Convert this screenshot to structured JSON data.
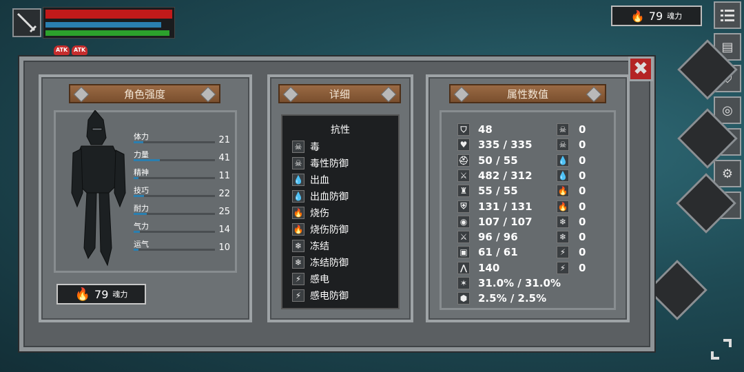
{
  "hud": {
    "atk1": "ATK",
    "atk2": "ATK"
  },
  "currency": {
    "value": "79",
    "unit": "魂力"
  },
  "right_menu": [
    "menu-icon",
    "map-icon",
    "armor-icon",
    "ring-icon",
    "crown-icon",
    "gear-icon",
    "help-icon"
  ],
  "help_label": "?",
  "close_label": "✖",
  "character": {
    "title": "角色强度",
    "stats": [
      {
        "label": "体力",
        "value": "21",
        "fill": 0.12
      },
      {
        "label": "力量",
        "value": "41",
        "fill": 0.32
      },
      {
        "label": "精神",
        "value": "11",
        "fill": 0.06
      },
      {
        "label": "技巧",
        "value": "22",
        "fill": 0.13
      },
      {
        "label": "耐力",
        "value": "25",
        "fill": 0.16
      },
      {
        "label": "气力",
        "value": "14",
        "fill": 0.08
      },
      {
        "label": "运气",
        "value": "10",
        "fill": 0.06
      }
    ],
    "soul_value": "79",
    "soul_unit": "魂力"
  },
  "details": {
    "title": "详细",
    "resist_header": "抗性",
    "resists": [
      {
        "icon": "skull-icon",
        "label": "毒"
      },
      {
        "icon": "skull-shield-icon",
        "label": "毒性防御"
      },
      {
        "icon": "blood-drop-icon",
        "label": "出血"
      },
      {
        "icon": "blood-shield-icon",
        "label": "出血防御"
      },
      {
        "icon": "fire-icon",
        "label": "烧伤"
      },
      {
        "icon": "fire-shield-icon",
        "label": "烧伤防御"
      },
      {
        "icon": "snowflake-icon",
        "label": "冻结"
      },
      {
        "icon": "snowflake-shield-icon",
        "label": "冻结防御"
      },
      {
        "icon": "lightning-icon",
        "label": "感电"
      },
      {
        "icon": "lightning-shield-icon",
        "label": "感电防御"
      }
    ]
  },
  "attributes": {
    "title": "属性数值",
    "left": [
      {
        "icon": "level-icon",
        "value": "48"
      },
      {
        "icon": "heart-icon",
        "value": "335 / 335"
      },
      {
        "icon": "helmet-icon",
        "value": "50 / 55"
      },
      {
        "icon": "sword-icon",
        "value": "482 / 312"
      },
      {
        "icon": "castle-icon",
        "value": "55 / 55"
      },
      {
        "icon": "shield-icon",
        "value": "131 / 131"
      },
      {
        "icon": "shield-round-icon",
        "value": "107 / 107"
      },
      {
        "icon": "crossed-swords-icon",
        "value": "96 / 96"
      },
      {
        "icon": "armor-icon",
        "value": "61 / 61"
      },
      {
        "icon": "lungs-icon",
        "value": "140"
      },
      {
        "icon": "star-icon",
        "value": "31.0% / 31.0%"
      },
      {
        "icon": "guard-icon",
        "value": "2.5% / 2.5%"
      }
    ],
    "right": [
      {
        "icon": "skull-icon",
        "value": "0"
      },
      {
        "icon": "skull-shield-icon",
        "value": "0"
      },
      {
        "icon": "blood-drop-icon",
        "value": "0"
      },
      {
        "icon": "blood-shield-icon",
        "value": "0"
      },
      {
        "icon": "fire-icon",
        "value": "0"
      },
      {
        "icon": "fire-shield-icon",
        "value": "0"
      },
      {
        "icon": "snowflake-icon",
        "value": "0"
      },
      {
        "icon": "snowflake-shield-icon",
        "value": "0"
      },
      {
        "icon": "lightning-icon",
        "value": "0"
      },
      {
        "icon": "lightning-shield-icon",
        "value": "0"
      }
    ]
  }
}
